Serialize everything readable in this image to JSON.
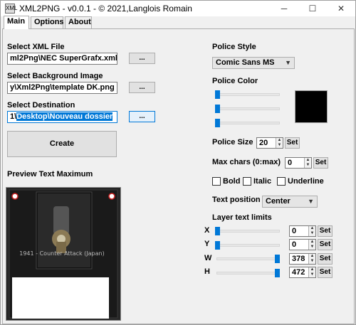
{
  "window": {
    "title": "XML2PNG - v0.0.1 - © 2021,Langlois Romain",
    "icon_text": "XML",
    "minimize": "─",
    "maximize": "☐",
    "close": "✕"
  },
  "tabs": [
    "Main",
    "Options",
    "About"
  ],
  "left": {
    "xml_label": "Select XML File",
    "xml_value": "ml2Png\\NEC SuperGrafx.xml",
    "bg_label": "Select Background Image",
    "bg_value": "y\\Xml2Png\\template DK.png",
    "dest_label": "Select Destination",
    "dest_prefix": "1\\",
    "dest_selected": "Desktop\\Nouveau dossier",
    "browse": "...",
    "create": "Create",
    "preview_label": "Preview Text Maximum",
    "preview_text": "1941 - Counter Attack (Japan)"
  },
  "right": {
    "police_style_label": "Police Style",
    "police_style_value": "Comic Sans MS",
    "police_color_label": "Police Color",
    "color_value": "#000000",
    "police_size_label": "Police Size",
    "police_size_value": "20",
    "max_chars_label": "Max chars (0:max)",
    "max_chars_value": "0",
    "set": "Set",
    "bold": "Bold",
    "italic": "Italic",
    "underline": "Underline",
    "text_position_label": "Text position",
    "text_position_value": "Center",
    "layer_label": "Layer text limits",
    "x_label": "X",
    "x_value": "0",
    "y_label": "Y",
    "y_value": "0",
    "w_label": "W",
    "w_value": "378",
    "h_label": "H",
    "h_value": "472"
  }
}
